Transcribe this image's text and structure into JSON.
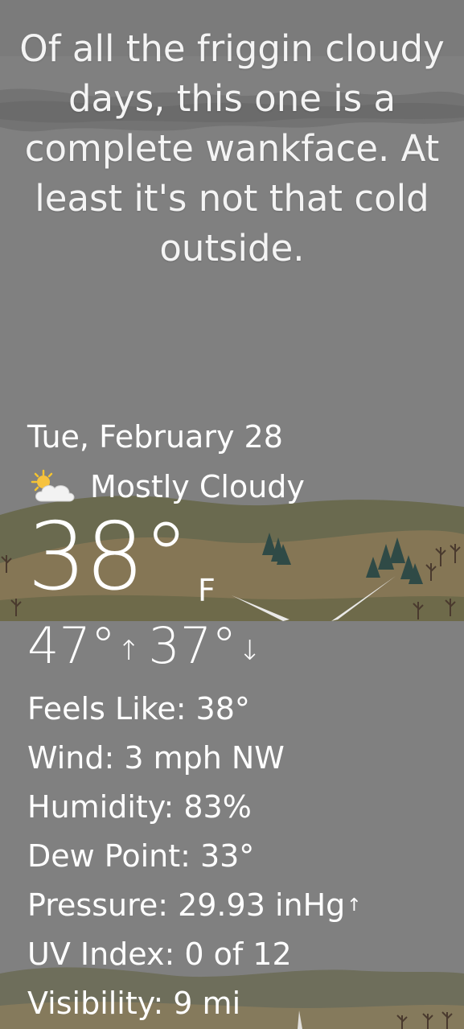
{
  "headline": "Of all the friggin cloudy days, this one is a complete wankface. At least it's not that cold outside.",
  "date": "Tue, February 28",
  "condition": {
    "icon": "partly-cloudy-icon",
    "text": "Mostly Cloudy"
  },
  "current": {
    "temp": "38°",
    "unit": "F"
  },
  "high_low": {
    "high": "47°",
    "high_arrow": "↑",
    "low": "37°",
    "low_arrow": "↓"
  },
  "details": {
    "feels_like_label": "Feels Like:",
    "feels_like_value": "38°",
    "wind_label": "Wind:",
    "wind_value": "3 mph NW",
    "humidity_label": "Humidity:",
    "humidity_value": "83%",
    "dew_point_label": "Dew Point:",
    "dew_point_value": "33°",
    "pressure_label": "Pressure:",
    "pressure_value": "29.93 inHg",
    "pressure_trend": "↑",
    "uv_label": "UV Index:",
    "uv_value": "0 of 12",
    "visibility_label": "Visibility:",
    "visibility_value": "9 mi"
  },
  "colors": {
    "sky": "#7f7f7f",
    "cloud_band": "#6e6e6e",
    "hills": "#6b6a4e",
    "field": "#8a7a58",
    "text": "#ffffff"
  }
}
